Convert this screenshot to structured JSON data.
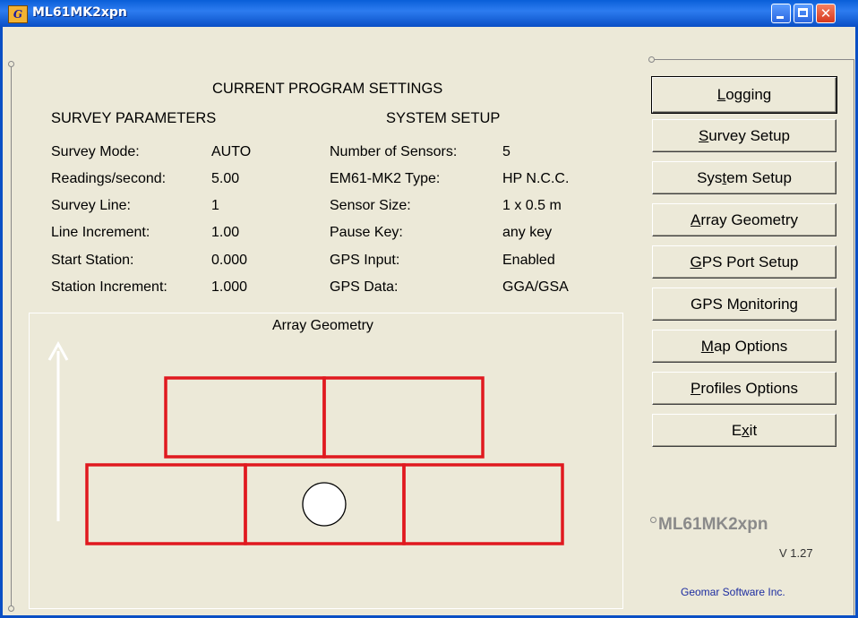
{
  "window": {
    "title": "ML61MK2xpn",
    "app_icon_text": "G",
    "close_glyph": "✕"
  },
  "settings": {
    "heading": "CURRENT PROGRAM SETTINGS",
    "survey": {
      "heading": "SURVEY PARAMETERS",
      "rows": [
        {
          "label": "Survey Mode:",
          "value": "AUTO"
        },
        {
          "label": "Readings/second:",
          "value": "5.00"
        },
        {
          "label": "Survey Line:",
          "value": "1"
        },
        {
          "label": "Line Increment:",
          "value": "1.00"
        },
        {
          "label": "Start Station:",
          "value": "0.000"
        },
        {
          "label": "Station Increment:",
          "value": "1.000"
        }
      ]
    },
    "system": {
      "heading": "SYSTEM SETUP",
      "rows": [
        {
          "label": "Number of Sensors:",
          "value": "5"
        },
        {
          "label": "EM61-MK2 Type:",
          "value": "HP N.C.C."
        },
        {
          "label": "Sensor Size:",
          "value": "1 x 0.5 m"
        },
        {
          "label": "Pause Key:",
          "value": "any key"
        },
        {
          "label": "GPS Input:",
          "value": "Enabled"
        },
        {
          "label": "GPS Data:",
          "value": "GGA/GSA"
        }
      ]
    }
  },
  "array_geometry": {
    "title": "Array Geometry",
    "sensor_color": "#e0191f",
    "arrow_color": "#ffffff"
  },
  "buttons": [
    {
      "pre": "",
      "key": "L",
      "post": "ogging"
    },
    {
      "pre": "",
      "key": "S",
      "post": "urvey Setup"
    },
    {
      "pre": "Sys",
      "key": "t",
      "post": "em Setup"
    },
    {
      "pre": "",
      "key": "A",
      "post": "rray Geometry"
    },
    {
      "pre": "",
      "key": "G",
      "post": "PS Port Setup"
    },
    {
      "pre": "GPS M",
      "key": "o",
      "post": "nitoring"
    },
    {
      "pre": "",
      "key": "M",
      "post": "ap Options"
    },
    {
      "pre": "",
      "key": "P",
      "post": "rofiles Options"
    },
    {
      "pre": "E",
      "key": "x",
      "post": "it"
    }
  ],
  "about": {
    "name": "ML61MK2xpn",
    "version": "V 1.27",
    "company": "Geomar Software Inc."
  },
  "colors": {
    "titlebar": "#0a5fd8",
    "background": "#ece9d8",
    "company_text": "#1c2ca0"
  }
}
